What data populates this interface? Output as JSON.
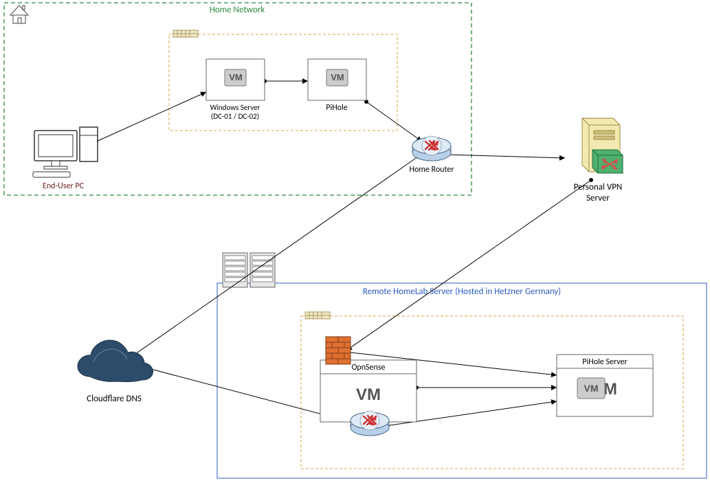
{
  "groups": {
    "home_network": {
      "label": "Home Network"
    },
    "virt_host_home": {},
    "remote_server_group": {
      "label": "Remote HomeLab Server (Hosted in Hetzner Germany)"
    },
    "virt_host_remote": {}
  },
  "nodes": {
    "end_user_pc": {
      "label": "End-User PC"
    },
    "win_server": {
      "label_line1": "Windows Server",
      "label_line2": "(DC-01 / DC-02)"
    },
    "pihole_home": {
      "label": "PiHole"
    },
    "home_router": {
      "label": "Home Router"
    },
    "vpn_server": {
      "label_line1": "Personal VPN",
      "label_line2": "Server"
    },
    "cloudflare": {
      "label": "Cloudflare DNS"
    },
    "opnsense": {
      "label": "OpnSense"
    },
    "remote_router": {},
    "pihole_remote": {
      "label": "PiHole Server"
    }
  }
}
